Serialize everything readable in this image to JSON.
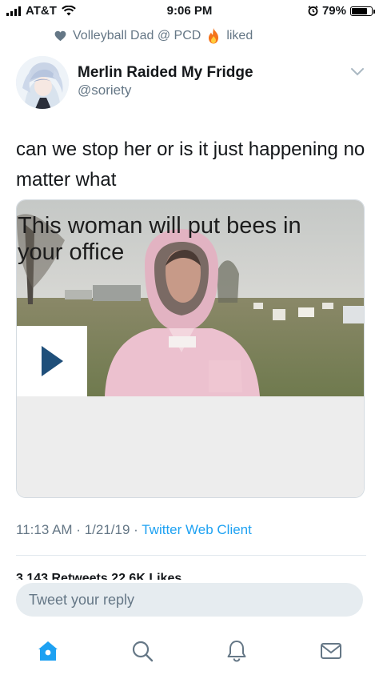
{
  "status_bar": {
    "carrier": "AT&T",
    "time": "9:06 PM",
    "battery": "79%",
    "battery_level": 0.79,
    "icons": [
      "signal-icon",
      "wifi-icon",
      "alarm-icon",
      "battery-icon"
    ]
  },
  "social_context": {
    "user": "Volleyball Dad @ PCD",
    "action": "liked",
    "icons": [
      "heart-icon",
      "fire-emoji-icon"
    ]
  },
  "tweet": {
    "author_name": "Merlin Raided My Fridge",
    "author_handle": "@soriety",
    "text": "can we stop her or is it just happening no matter what",
    "card": {
      "title": "This woman will put bees in your office",
      "media_type": "video",
      "icon": "play-icon"
    },
    "time": "11:13 AM",
    "date": "1/21/19",
    "client": "Twitter Web Client",
    "stats_peek": "3,143 Retweets  22.6K Likes"
  },
  "reply": {
    "placeholder": "Tweet your reply"
  },
  "tab_bar": {
    "items": [
      {
        "name": "home",
        "icon": "home-icon",
        "active": true
      },
      {
        "name": "search",
        "icon": "search-icon",
        "active": false
      },
      {
        "name": "notifications",
        "icon": "bell-icon",
        "active": false
      },
      {
        "name": "messages",
        "icon": "mail-icon",
        "active": false
      }
    ]
  },
  "colors": {
    "accent": "#1da1f2",
    "secondary_text": "#657786",
    "text": "#14171a",
    "caption_bg": "#ededed",
    "play": "#1f4f7a"
  }
}
